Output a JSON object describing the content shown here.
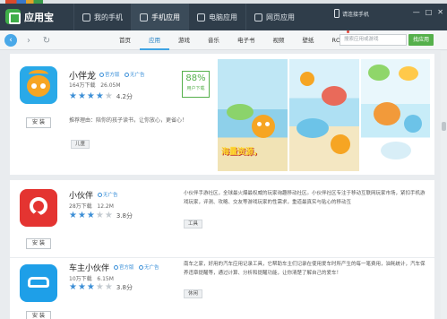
{
  "window": {
    "app_name": "应用宝",
    "tabs": [
      {
        "label": "我的手机",
        "active": false
      },
      {
        "label": "手机应用",
        "active": true
      },
      {
        "label": "电脑应用",
        "active": false
      },
      {
        "label": "网页应用",
        "active": false
      }
    ],
    "connect_label": "请连接手机",
    "controls": {
      "minimize": "—",
      "maximize": "□",
      "close": "✕"
    }
  },
  "nav": {
    "back": "‹",
    "forward": "›",
    "refresh": "↻",
    "tabs": [
      "首页",
      "应用",
      "游戏",
      "音乐",
      "电子书",
      "视频",
      "壁纸",
      "ROM"
    ],
    "active_tab": "应用",
    "search_placeholder": "搜索应用或游戏",
    "search_button": "找应用"
  },
  "apps": [
    {
      "name": "小伴龙",
      "badges": [
        "官方版",
        "无广告"
      ],
      "downloads": "164万下载",
      "size": "26.05M",
      "stars": "★★★★",
      "stars_empty": "★",
      "score": "4.2分",
      "recommend": "推荐理由：陪你的孩子读书，让你放心，更省心！",
      "tag": "儿童",
      "install": "安 装",
      "rate_pct": "88%",
      "rate_label": "用户下载",
      "screenshot_title": "海量资源，"
    },
    {
      "name": "小伙伴",
      "badges": [
        "无广告"
      ],
      "downloads": "28万下载",
      "size": "12.2M",
      "stars": "★★★",
      "stars_empty": "★★",
      "score": "3.8分",
      "desc_left": "小伙伴手游社区，全球最火爆最权威的玩家询趣移动社区。小伙伴社区专注于移动互联网玩家市场，紧扣手机游戏玩家，评测、攻略、交友等游戏玩家的性需求，重道最真实与贴心的移动互",
      "tag": "工具",
      "install": "安 装"
    },
    {
      "name": "车主小伙伴",
      "badges": [
        "官方版",
        "无广告"
      ],
      "downloads": "10万下载",
      "size": "6.15M",
      "stars": "★★★",
      "stars_empty": "★★",
      "score": "3.8分",
      "desc_left": "南车之家，好用的汽车应用记录工具，它帮助车主们记录在使用爱车时所产生的每一笔费用，油耗统计，汽车保养违章提醒等，通过计算、分析和提醒功能，让你清楚了解自己的爱车！",
      "tag": "休闲",
      "install": "安 装"
    }
  ]
}
